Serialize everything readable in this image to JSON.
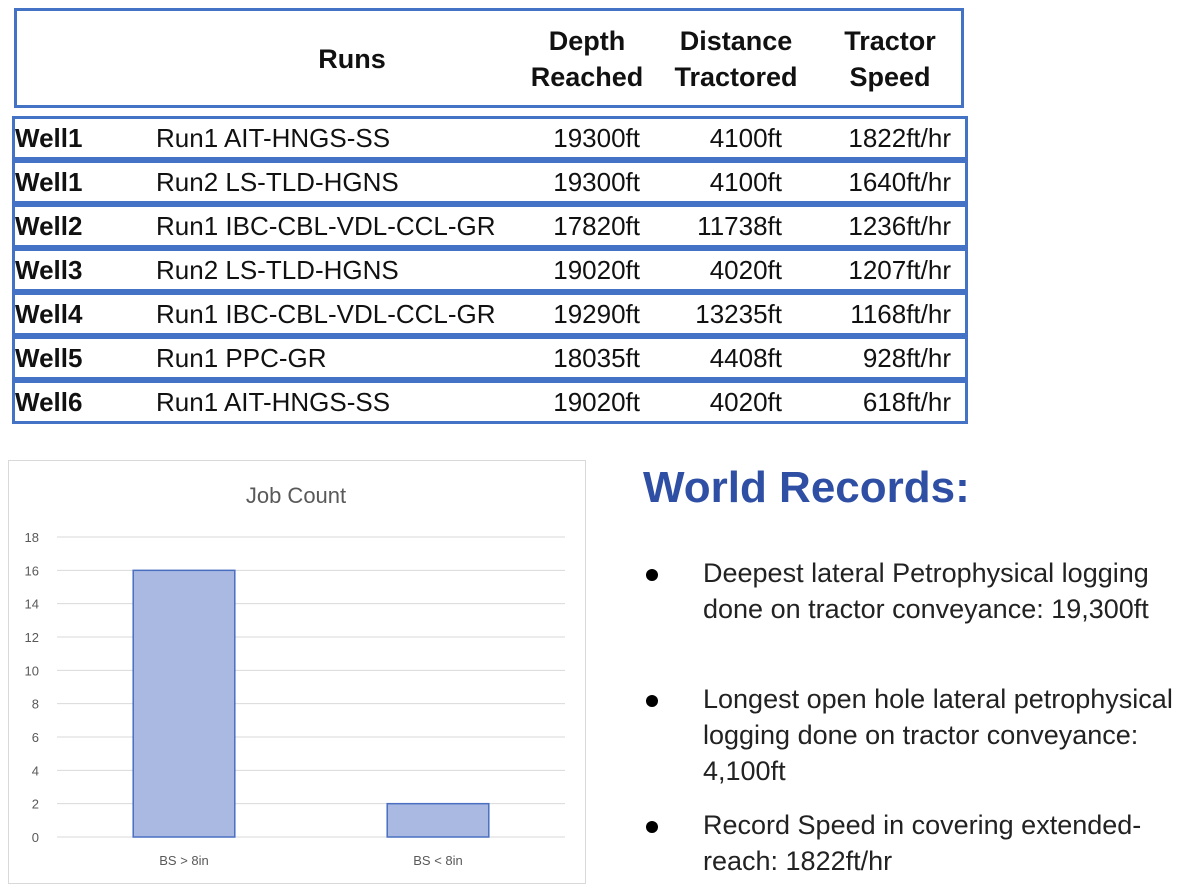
{
  "table": {
    "headers": {
      "runs": "Runs",
      "depth": "Depth\nReached",
      "distance": "Distance\nTractored",
      "speed": "Tractor\nSpeed"
    },
    "rows": [
      {
        "well": "Well1",
        "run": "Run1 AIT-HNGS-SS",
        "depth": "19300ft",
        "distance": "4100ft",
        "speed": "1822ft/hr"
      },
      {
        "well": "Well1",
        "run": "Run2 LS-TLD-HGNS",
        "depth": "19300ft",
        "distance": "4100ft",
        "speed": "1640ft/hr"
      },
      {
        "well": "Well2",
        "run": "Run1 IBC-CBL-VDL-CCL-GR",
        "depth": "17820ft",
        "distance": "11738ft",
        "speed": "1236ft/hr"
      },
      {
        "well": "Well3",
        "run": "Run2 LS-TLD-HGNS",
        "depth": "19020ft",
        "distance": "4020ft",
        "speed": "1207ft/hr"
      },
      {
        "well": "Well4",
        "run": "Run1 IBC-CBL-VDL-CCL-GR",
        "depth": "19290ft",
        "distance": "13235ft",
        "speed": "1168ft/hr"
      },
      {
        "well": "Well5",
        "run": "Run1 PPC-GR",
        "depth": "18035ft",
        "distance": "4408ft",
        "speed": "928ft/hr"
      },
      {
        "well": "Well6",
        "run": "Run1 AIT-HNGS-SS",
        "depth": "19020ft",
        "distance": "4020ft",
        "speed": "618ft/hr"
      }
    ]
  },
  "chart_data": {
    "type": "bar",
    "title": "Job Count",
    "categories": [
      "BS > 8in",
      "BS < 8in"
    ],
    "values": [
      16,
      2
    ],
    "xlabel": "",
    "ylabel": "",
    "ylim": [
      0,
      18
    ],
    "yticks": [
      0,
      2,
      4,
      6,
      8,
      10,
      12,
      14,
      16,
      18
    ],
    "grid": true,
    "legend": "none",
    "bar_color": "#a9b9e2",
    "bar_edge_color": "#4a6fc1"
  },
  "records": {
    "title": "World Records:",
    "items": [
      "Deepest lateral Petrophysical logging done on tractor conveyance: 19,300ft",
      "Longest open hole lateral petrophysical logging done on tractor conveyance: 4,100ft",
      "Record Speed in covering extended-reach: 1822ft/hr"
    ]
  },
  "colors": {
    "table_border": "#4472c4",
    "title_blue": "#2e4fa3"
  }
}
